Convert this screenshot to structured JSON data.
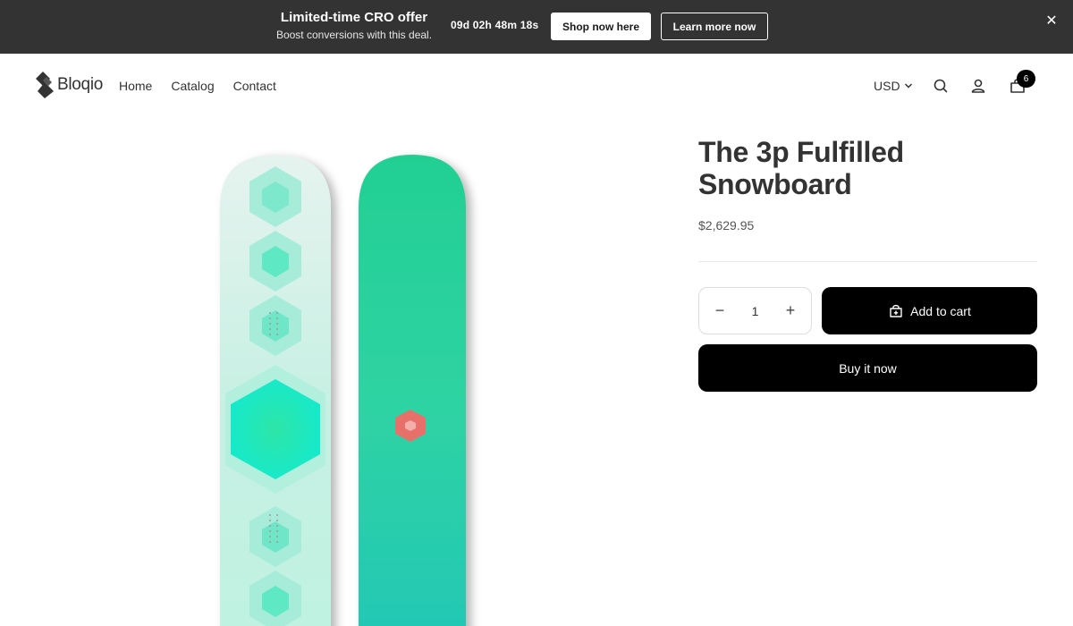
{
  "promo": {
    "title": "Limited-time CRO offer",
    "subtitle": "Boost conversions with this deal.",
    "countdown": "09d 02h 48m 18s",
    "shop_label": "Shop now here",
    "learn_label": "Learn more now",
    "close_icon": "close-icon",
    "close_glyph": "✕"
  },
  "header": {
    "logo_text": "Bloqio",
    "nav": [
      "Home",
      "Catalog",
      "Contact"
    ],
    "currency": "USD",
    "icons": [
      "search-icon",
      "account-icon",
      "cart-icon"
    ],
    "cart_count": "6"
  },
  "product": {
    "title": "The 3p Fulfilled Snowboard",
    "price": "$2,629.95",
    "quantity": "1",
    "decrement": "−",
    "increment": "+",
    "add_to_cart": "Add to cart",
    "buy_now": "Buy it now"
  },
  "colors": {
    "promo_bg": "#333333",
    "button_bg": "#000000",
    "board_front": "#cdf0e4",
    "board_back": "#22cf9a",
    "accent_hex": "#e8706a"
  }
}
